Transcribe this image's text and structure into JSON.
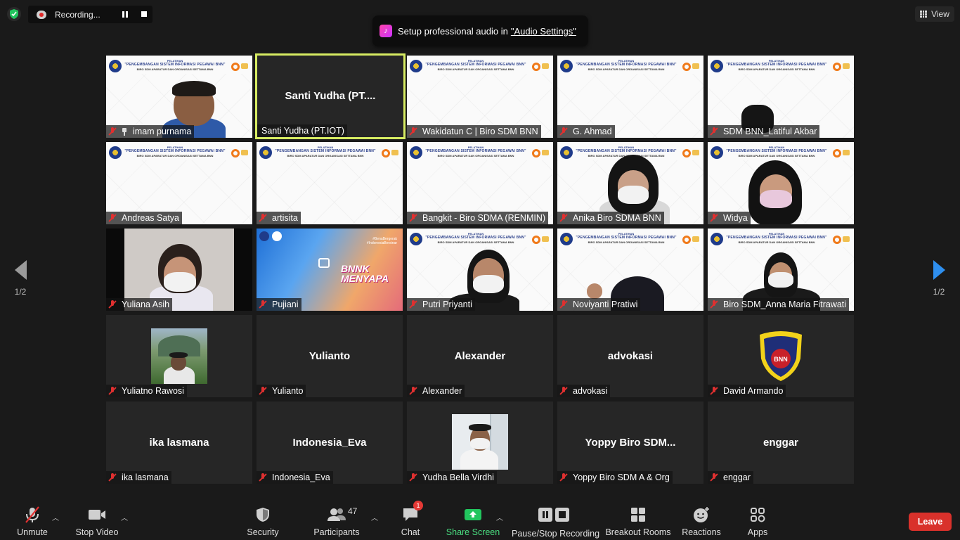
{
  "top": {
    "recording_label": "Recording...",
    "audio_banner_text": "Setup professional audio in",
    "audio_banner_link": "\"Audio Settings\"",
    "view_label": "View"
  },
  "nav": {
    "page_left": "1/2",
    "page_right": "1/2"
  },
  "slide": {
    "line1": "PELATIHAN",
    "line2": "\"PENGEMBANGAN SISTEM INFORMASI PEGAWAI BNN\"",
    "line3": "BIRO SDM APARATUR DAN ORGANISASI SETTAMA BNN"
  },
  "tiles": [
    {
      "name": "imam purnama"
    },
    {
      "name": "Santi Yudha (PT.IOT)",
      "center": "Santi  Yudha  (PT...."
    },
    {
      "name": "Wakidatun C | Biro SDM BNN"
    },
    {
      "name": "G. Ahmad"
    },
    {
      "name": "SDM BNN_Latiful Akbar"
    },
    {
      "name": "Andreas Satya"
    },
    {
      "name": "artisita"
    },
    {
      "name": "Bangkit - Biro SDMA (RENMIN)"
    },
    {
      "name": "Anika Biro SDMA BNN"
    },
    {
      "name": "Widya"
    },
    {
      "name": "Yuliana Asih"
    },
    {
      "name": "Pujiani",
      "poster_text": "BNNK MENYAPA",
      "poster_tags": "#BenaBergerak #IndonesiaBersinar"
    },
    {
      "name": "Putri Priyanti"
    },
    {
      "name": "Noviyanti Pratiwi"
    },
    {
      "name": "Biro SDM_Anna Maria Fitrawati"
    },
    {
      "name": "Yuliatno Rawosi"
    },
    {
      "name": "Yulianto",
      "center": "Yulianto"
    },
    {
      "name": "Alexander",
      "center": "Alexander"
    },
    {
      "name": "advokasi",
      "center": "advokasi"
    },
    {
      "name": "David Armando",
      "emblem_text": "BNN"
    },
    {
      "name": "ika lasmana",
      "center": "ika lasmana"
    },
    {
      "name": "Indonesia_Eva",
      "center": "Indonesia_Eva"
    },
    {
      "name": "Yudha Bella Virdhi"
    },
    {
      "name": "Yoppy Biro SDM A & Org",
      "center": "Yoppy  Biro  SDM..."
    },
    {
      "name": "enggar",
      "center": "enggar"
    }
  ],
  "toolbar": {
    "unmute": "Unmute",
    "stop_video": "Stop Video",
    "security": "Security",
    "participants": "Participants",
    "participants_count": "47",
    "chat": "Chat",
    "chat_badge": "1",
    "share_screen": "Share Screen",
    "recording": "Pause/Stop Recording",
    "breakout": "Breakout Rooms",
    "reactions": "Reactions",
    "apps": "Apps",
    "leave": "Leave"
  },
  "colors": {
    "background": "#1a1a1a",
    "tile": "#262626",
    "active_outline": "#d7ec62",
    "muted_red": "#e03030",
    "share_green": "#22c55e",
    "leave_red": "#d9312b",
    "nav_blue": "#2e8fef"
  }
}
